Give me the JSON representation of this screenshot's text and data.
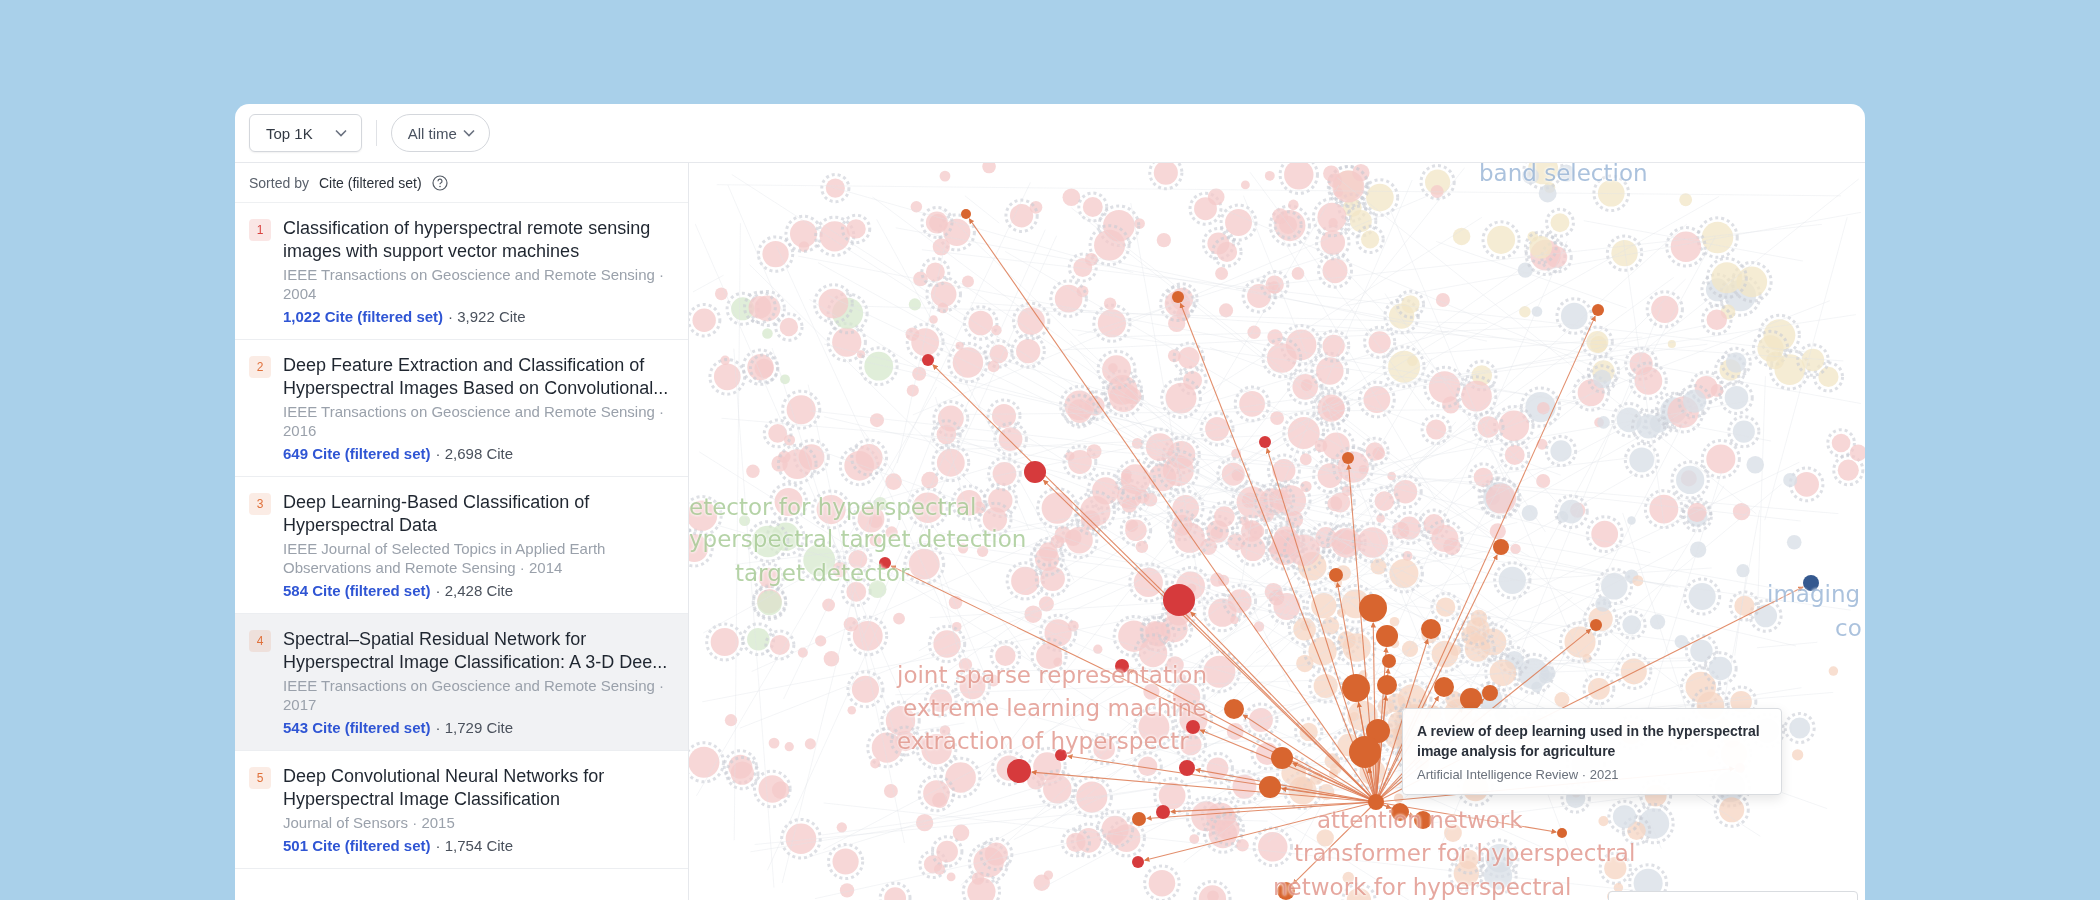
{
  "toolbar": {
    "filters": [
      {
        "label": "Top 1K",
        "kind": "select"
      },
      {
        "label": "All time",
        "kind": "pill"
      }
    ]
  },
  "sort": {
    "prefix": "Sorted by",
    "value": "Cite (filtered set)"
  },
  "papers": [
    {
      "rank": "1",
      "color": "#d9433f",
      "title": "Classification of hyperspectral remote sensing images with support vector machines",
      "venue": "IEEE Transactions on Geoscience and Remote Sensing · 2004",
      "filtered_cites": "1,022 Cite (filtered set)",
      "cites": "· 3,922 Cite",
      "selected": false
    },
    {
      "rank": "2",
      "color": "#e0703a",
      "title": "Deep Feature Extraction and Classification of Hyperspectral Images Based on Convolutional...",
      "venue": "IEEE Transactions on Geoscience and Remote Sensing · 2016",
      "filtered_cites": "649 Cite (filtered set)",
      "cites": "· 2,698 Cite",
      "selected": false
    },
    {
      "rank": "3",
      "color": "#e0703a",
      "title": "Deep Learning-Based Classification of Hyperspectral Data",
      "venue": "IEEE Journal of Selected Topics in Applied Earth Observations and Remote Sensing · 2014",
      "filtered_cites": "584 Cite (filtered set)",
      "cites": "· 2,428 Cite",
      "selected": false
    },
    {
      "rank": "4",
      "color": "#e0703a",
      "title": "Spectral–Spatial Residual Network for Hyperspectral Image Classification: A 3-D Dee...",
      "venue": "IEEE Transactions on Geoscience and Remote Sensing · 2017",
      "filtered_cites": "543 Cite (filtered set)",
      "cites": "· 1,729 Cite",
      "selected": true
    },
    {
      "rank": "5",
      "color": "#e0703a",
      "title": "Deep Convolutional Neural Networks for Hyperspectral Image Classification",
      "venue": "Journal of Sensors · 2015",
      "filtered_cites": "501 Cite (filtered set)",
      "cites": "· 1,754 Cite",
      "selected": false
    }
  ],
  "graph": {
    "cluster_labels": [
      {
        "text": "band selection",
        "color": "#9db8d8"
      },
      {
        "text": "etector for hyperspectral",
        "color": "#a9cc98"
      },
      {
        "text": "yperspectral target detection",
        "color": "#a9cc98"
      },
      {
        "text": "target detector",
        "color": "#a9cc98"
      },
      {
        "text": "joint sparse representation",
        "color": "#e29a90"
      },
      {
        "text": "extreme learning machine",
        "color": "#e29a90"
      },
      {
        "text": "extraction of hyperspectr",
        "color": "#e29a90"
      },
      {
        "text": "attention network",
        "color": "#e29a90"
      },
      {
        "text": "transformer for hyperspectral",
        "color": "#e29a90"
      },
      {
        "text": "network for hyperspectral",
        "color": "#e29a90"
      },
      {
        "text": "imaging",
        "color": "#9db8d8"
      },
      {
        "text": "co",
        "color": "#9db8d8"
      }
    ],
    "tooltip": {
      "title": "A review of deep learning used in the hyperspectral image analysis for agriculture",
      "meta": "Artificial Intelligence Review · 2021"
    }
  }
}
